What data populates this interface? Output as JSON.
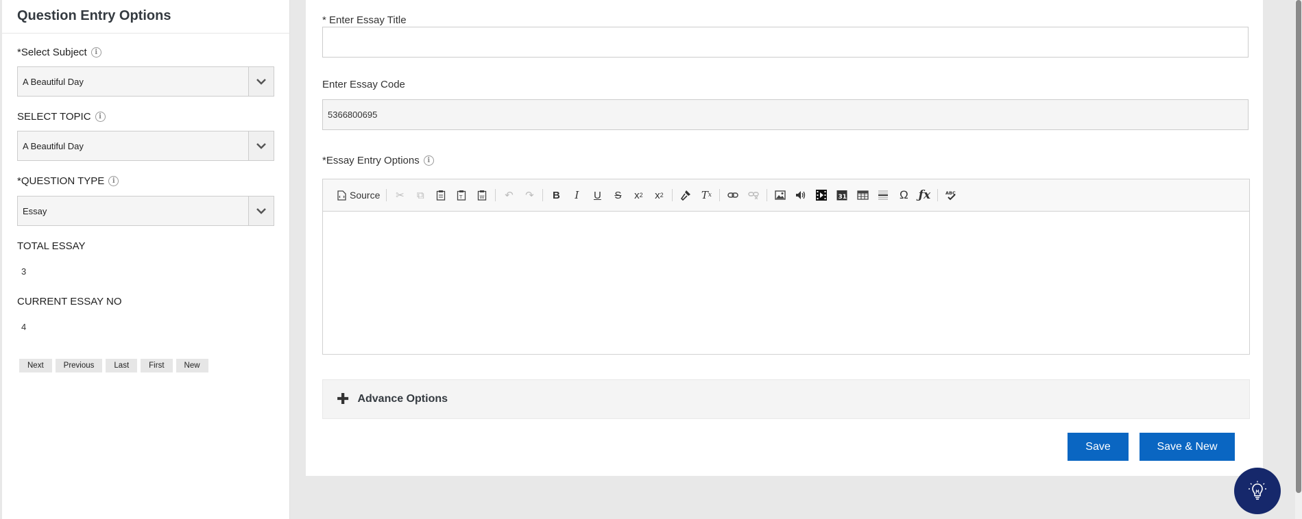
{
  "sidebar": {
    "title": "Question Entry Options",
    "subject": {
      "label": "*Select Subject",
      "value": "A Beautiful Day"
    },
    "topic": {
      "label": "SELECT TOPIC",
      "value": "A Beautiful Day"
    },
    "question_type": {
      "label": "*QUESTION TYPE",
      "value": "Essay"
    },
    "total_essay": {
      "label": "TOTAL ESSAY",
      "value": "3"
    },
    "current_essay": {
      "label": "CURRENT ESSAY NO",
      "value": "4"
    },
    "nav": {
      "next": "Next",
      "previous": "Previous",
      "last": "Last",
      "first": "First",
      "new": "New"
    }
  },
  "main": {
    "title_label": "* Enter Essay Title",
    "title_value": "",
    "code_label": "Enter Essay Code",
    "code_value": "5366800695",
    "entry_label": "*Essay Entry Options",
    "toolbar": {
      "source": "Source"
    },
    "advance_label": "Advance Options",
    "save_label": "Save",
    "save_new_label": "Save & New"
  },
  "colors": {
    "primary": "#0a66c2",
    "bulb_bg": "#16286b",
    "page_bg": "#e8e8e8"
  }
}
